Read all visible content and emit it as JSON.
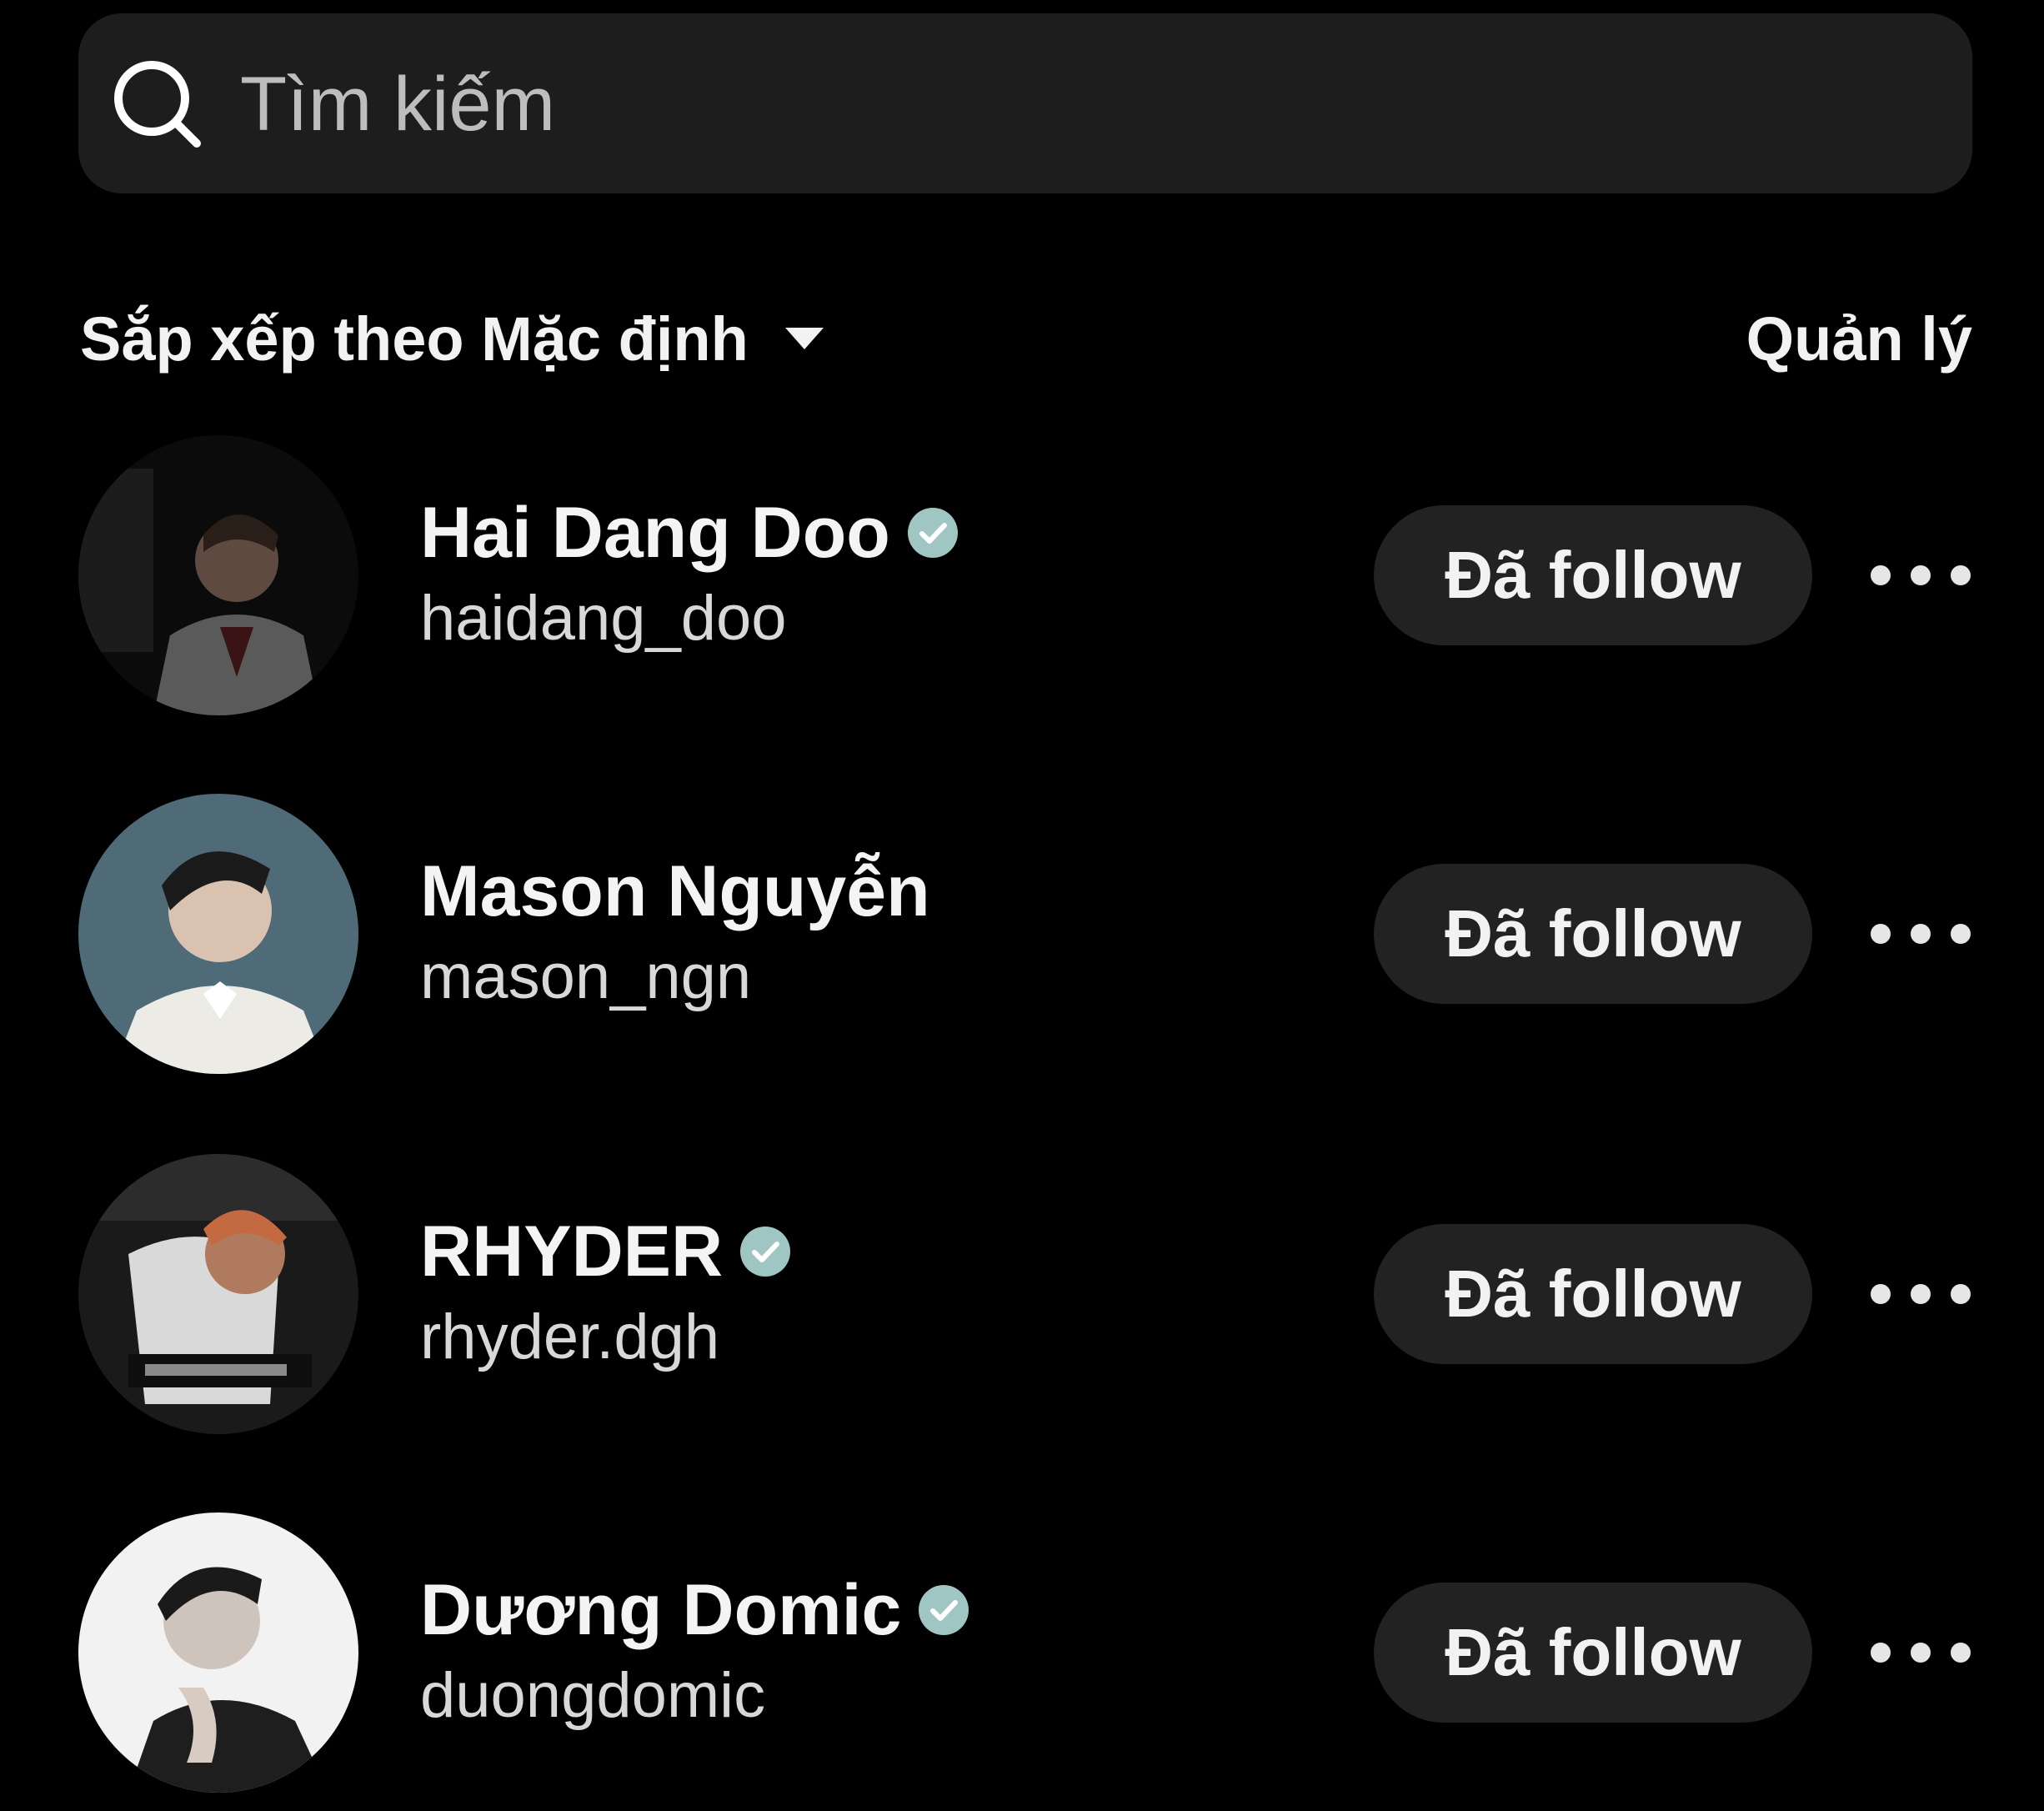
{
  "search": {
    "placeholder": "Tìm kiếm",
    "icon": "search-icon"
  },
  "sort": {
    "label": "Sắp xếp theo Mặc định",
    "icon": "caret-down-icon"
  },
  "manage": {
    "label": "Quản lý"
  },
  "colors": {
    "background": "#000000",
    "surface": "#1d1d1d",
    "button": "#222222",
    "verified": "#9fc6c3",
    "text_primary": "#f4f4f4",
    "text_secondary": "#d8d8d8"
  },
  "users": [
    {
      "display_name": "Hai Dang Doo",
      "username": "haidang_doo",
      "verified": true,
      "button_label": "Đã follow"
    },
    {
      "display_name": "Mason Nguyễn",
      "username": "mason_ngn",
      "verified": false,
      "button_label": "Đã follow"
    },
    {
      "display_name": "RHYDER",
      "username": "rhyder.dgh",
      "verified": true,
      "button_label": "Đã follow"
    },
    {
      "display_name": "Dương Domic",
      "username": "duongdomic",
      "verified": true,
      "button_label": "Đã follow"
    }
  ]
}
